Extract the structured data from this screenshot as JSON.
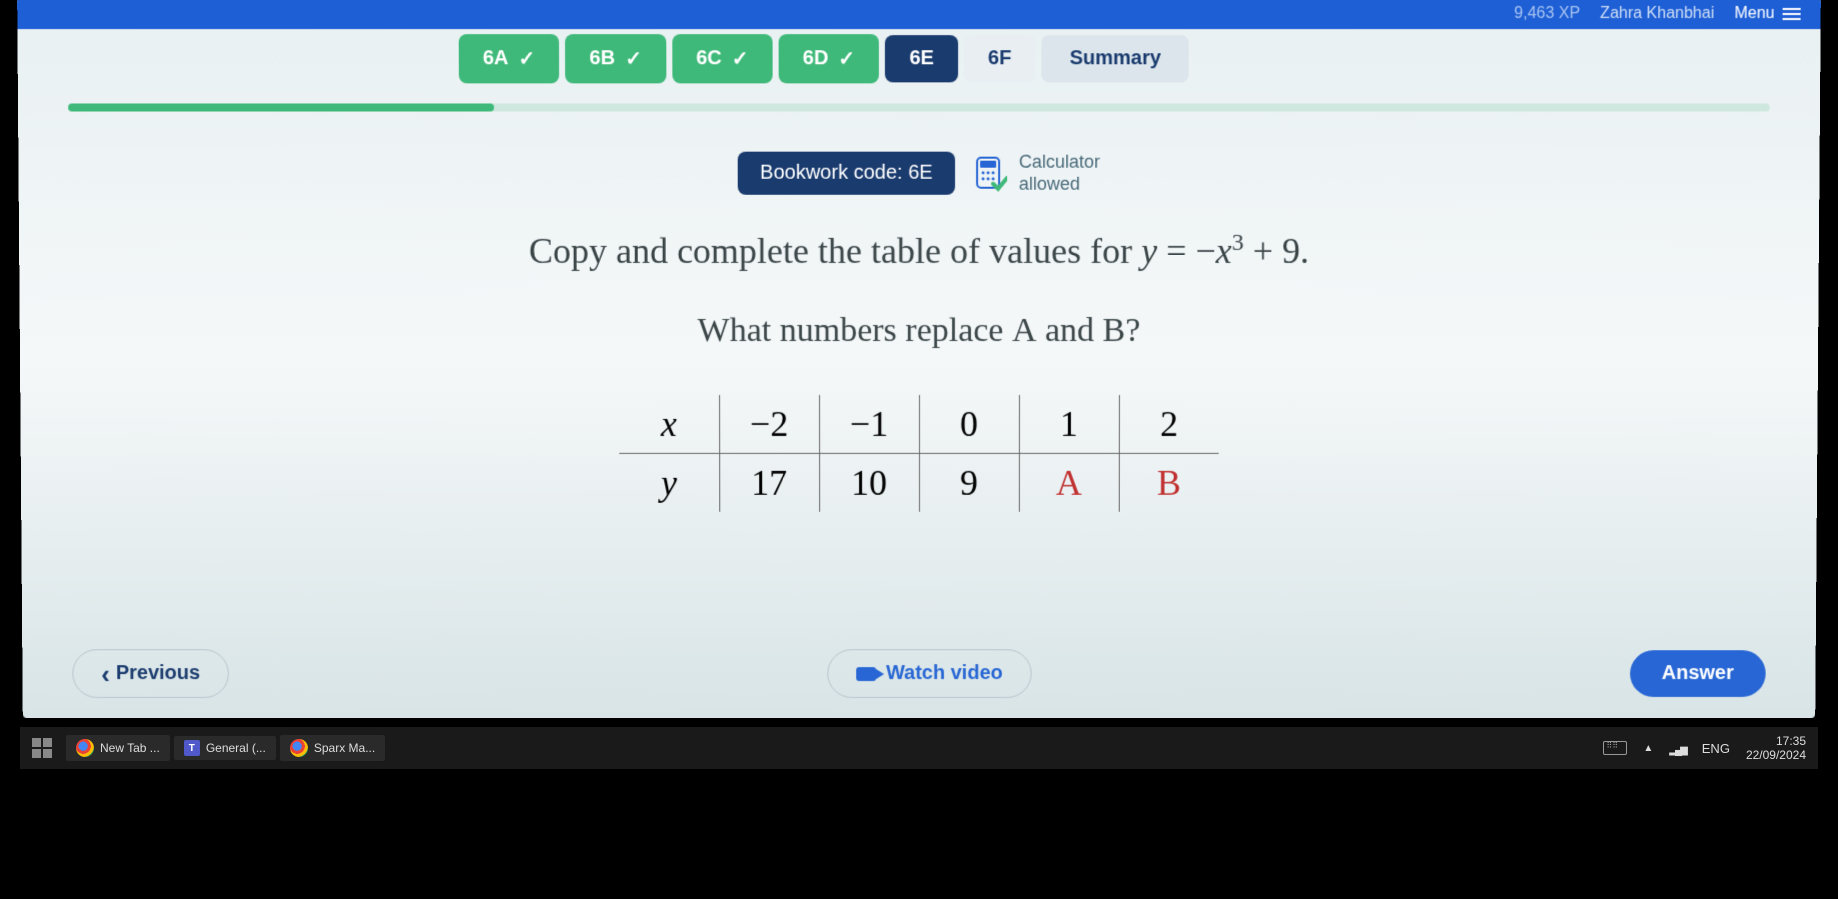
{
  "header": {
    "xp": "9,463 XP",
    "user": "Zahra Khanbhai",
    "menu": "Menu"
  },
  "tabs": [
    {
      "label": "6A",
      "state": "done"
    },
    {
      "label": "6B",
      "state": "done"
    },
    {
      "label": "6C",
      "state": "done"
    },
    {
      "label": "6D",
      "state": "done"
    },
    {
      "label": "6E",
      "state": "active"
    },
    {
      "label": "6F",
      "state": "pending"
    }
  ],
  "summary_label": "Summary",
  "bookwork": "Bookwork code: 6E",
  "calculator": {
    "line1": "Calculator",
    "line2": "allowed"
  },
  "question": {
    "prompt_prefix": "Copy and complete the table of values for ",
    "equation_lhs": "y",
    "equation_rhs_prefix": " = −",
    "equation_var": "x",
    "equation_exp": "3",
    "equation_suffix": " + 9.",
    "sub_prompt_prefix": "What numbers replace ",
    "sub_a": "A",
    "sub_mid": " and ",
    "sub_b": "B",
    "sub_suffix": "?"
  },
  "table": {
    "x_label": "x",
    "y_label": "y",
    "x_values": [
      "−2",
      "−1",
      "0",
      "1",
      "2"
    ],
    "y_values": [
      "17",
      "10",
      "9",
      "A",
      "B"
    ]
  },
  "buttons": {
    "previous": "Previous",
    "watch_video": "Watch video",
    "answer": "Answer"
  },
  "taskbar": {
    "items": [
      "New Tab ...",
      "General (...",
      "Sparx Ma..."
    ],
    "teams_badge": "T",
    "lang": "ENG",
    "time": "17:35",
    "date": "22/09/2024"
  }
}
